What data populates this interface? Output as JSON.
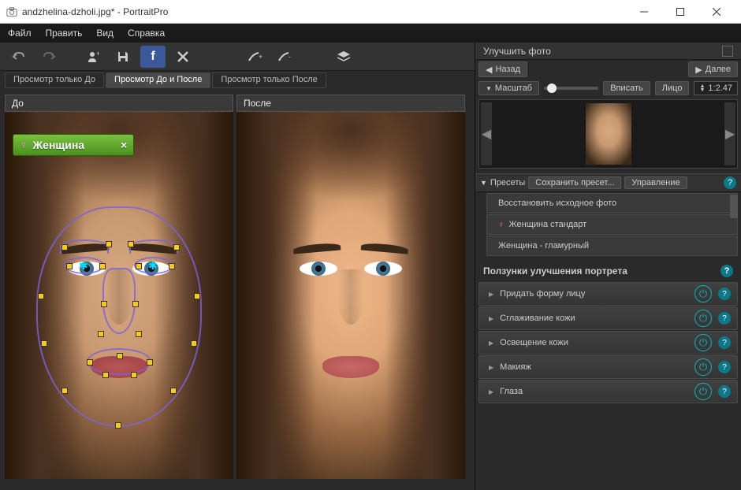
{
  "window": {
    "title": "andzhelina-dzholi.jpg* - PortraitPro"
  },
  "menu": {
    "file": "Файл",
    "edit": "Править",
    "view": "Вид",
    "help": "Справка"
  },
  "rightPanel": {
    "title": "Улучшить фото",
    "back": "Назад",
    "next": "Далее",
    "zoomLabel": "Масштаб",
    "fit": "Вписать",
    "face": "Лицо",
    "ratio": "1:2.47"
  },
  "presets": {
    "header": "Пресеты",
    "save": "Сохранить пресет...",
    "manage": "Управление",
    "items": [
      "Восстановить исходное фото",
      "Женщина стандарт",
      "Женщина - гламурный"
    ]
  },
  "controls": {
    "title": "Ползунки улучшения портрета",
    "items": [
      "Придать форму лицу",
      "Сглаживание кожи",
      "Освещение кожи",
      "Макияж",
      "Глаза"
    ]
  },
  "viewTabs": {
    "before": "Просмотр только До",
    "both": "Просмотр До и После",
    "after": "Просмотр только После"
  },
  "panes": {
    "before": "До",
    "after": "После"
  },
  "genderTag": {
    "label": "Женщина"
  }
}
